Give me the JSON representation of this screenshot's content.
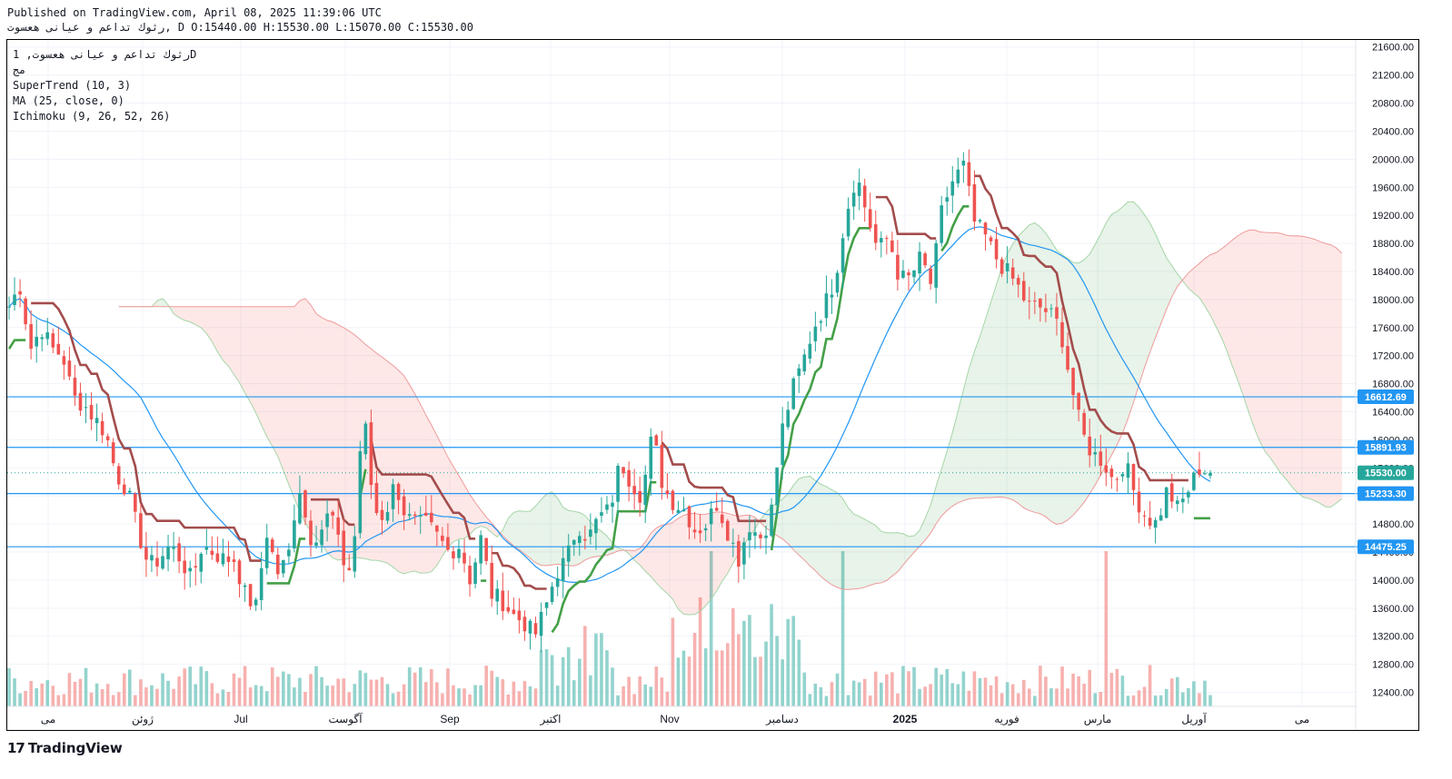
{
  "header": {
    "published": "Published on TradingView.com, April 08, 2025 11:39:06 UTC",
    "ohlc": "ﺭﺛﻮﻙ ﺗﺪﺍﻋﻢ ﻭ ﻋﻴﺎﻧﻰ ﻫﻌﺴﻮﺕ, D O:15440.00 H:15530.00 L:15070.00 C:15530.00"
  },
  "legend": {
    "symbol": "ﺭﺛﻮﻙ ﺗﺪﺍﻋﻢ ﻭ ﻋﻴﺎﻧﻰ ﻫﻌﺴﻮﺕ, 1D",
    "sub": "ﻣﺞ",
    "indicators": [
      "SuperTrend (10, 3)",
      "MA (25, close, 0)",
      "Ichimoku (9, 26, 52, 26)"
    ]
  },
  "brand": {
    "name": "TradingView",
    "icon": "tradingview-logo-icon"
  },
  "colors": {
    "up": "#26a69a",
    "down": "#ef5350",
    "ma": "#2196f3",
    "st_up": "#43a047",
    "st_down": "#a34c4c",
    "level": "#2196f3"
  },
  "chart_data": {
    "type": "candlestick",
    "y_axis": {
      "range": [
        12200,
        21700
      ],
      "ticks": [
        12400,
        12800,
        13200,
        13600,
        14000,
        14400,
        14800,
        15200,
        15600,
        16000,
        16400,
        16800,
        17200,
        17600,
        18000,
        18400,
        18800,
        19200,
        19600,
        20000,
        20400,
        20800,
        21200,
        21600
      ],
      "tick_labels": [
        "12400.00",
        "12800.00",
        "13200.00",
        "13600.00",
        "14000.00",
        "14400.00",
        "14800.00",
        "15200.00",
        "15600.00",
        "16000.00",
        "16400.00",
        "16800.00",
        "17200.00",
        "17600.00",
        "18000.00",
        "18400.00",
        "18800.00",
        "19200.00",
        "19600.00",
        "20000.00",
        "20400.00",
        "20800.00",
        "21200.00",
        "21600.00"
      ]
    },
    "x_axis": {
      "labels": [
        "ﻣﻰ",
        "ﮊﻭﺋﻦ",
        "Jul",
        "ﺁﮔﻮﺳﺖ",
        "Sep",
        "ﺍﻛﺘﺒﺮ",
        "Nov",
        "ﺩﺳﺎﻣﺒﺮ",
        "2025",
        "ﻓﻮﺭﻳﻪ",
        "ﻣﺎﺭﺱ",
        "ﺁﻭﺭﻳﻞ",
        "ﻣﻰ"
      ],
      "bold": [
        false,
        false,
        false,
        false,
        false,
        false,
        false,
        false,
        true,
        false,
        false,
        false,
        false
      ]
    },
    "levels": [
      {
        "value": 16612.69,
        "label": "16612.69"
      },
      {
        "value": 15891.93,
        "label": "15891.93"
      },
      {
        "value": 15233.3,
        "label": "15233.30"
      },
      {
        "value": 14475.25,
        "label": "14475.25"
      }
    ],
    "last_price": {
      "value": 15530.0,
      "label": "15530.00"
    },
    "anchors": [
      [
        17900,
        18200,
        17300
      ],
      [
        17600,
        17300,
        17200
      ],
      [
        16600,
        16500,
        16300
      ],
      [
        16100,
        15500,
        15300
      ],
      [
        14700,
        14200,
        14300
      ],
      [
        14500,
        14300,
        14000
      ],
      [
        14500,
        14400,
        14300
      ],
      [
        14300,
        13800,
        13600
      ],
      [
        14700,
        14100,
        14300
      ],
      [
        15400,
        14600,
        14700
      ],
      [
        15000,
        14300,
        14100
      ],
      [
        16500,
        15000,
        14900
      ],
      [
        15400,
        14900,
        14800
      ],
      [
        14800,
        14600,
        14400
      ],
      [
        14500,
        14000,
        14600
      ],
      [
        13800,
        13700,
        13500
      ],
      [
        13400,
        13200,
        13600
      ],
      [
        14100,
        14300,
        14800
      ],
      [
        14600,
        14900,
        15000
      ],
      [
        15700,
        15400,
        15200
      ],
      [
        16100,
        15300,
        15100
      ],
      [
        15000,
        14700,
        14800
      ],
      [
        15100,
        14700,
        14300
      ],
      [
        14800,
        14600,
        14900
      ],
      [
        16100,
        16700,
        17100
      ],
      [
        17600,
        17900,
        18300
      ],
      [
        19200,
        19800,
        19200
      ],
      [
        18700,
        18900,
        18300
      ],
      [
        18300,
        18600,
        18200
      ],
      [
        19300,
        19700,
        19900
      ],
      [
        19100,
        18900,
        18600
      ],
      [
        18400,
        18200,
        17900
      ],
      [
        17900,
        17800,
        17600
      ],
      [
        16800,
        16100,
        15800
      ],
      [
        15700,
        15400,
        15700
      ],
      [
        15200,
        14900,
        14800
      ],
      [
        15300,
        15000,
        15300
      ],
      [
        15600,
        15530
      ]
    ],
    "volume_range": [
      0,
      5000
    ]
  }
}
